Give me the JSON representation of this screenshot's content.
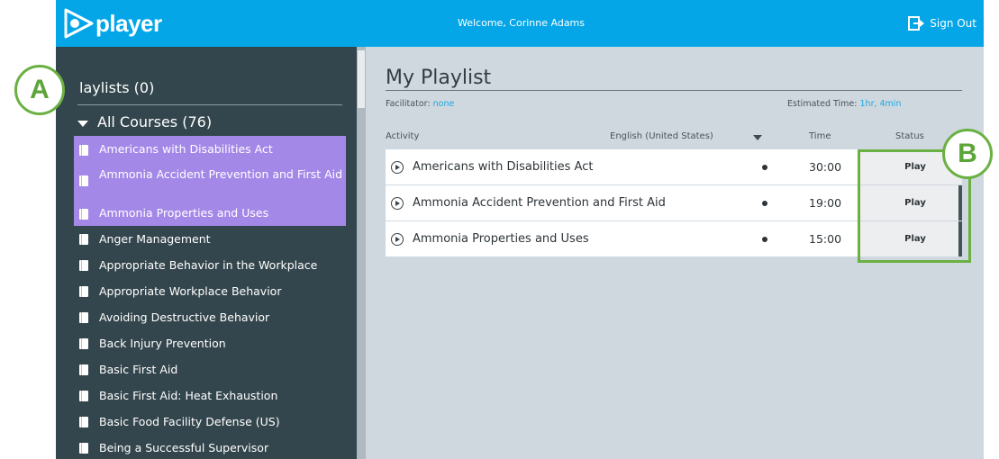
{
  "header": {
    "logo_text": "player",
    "welcome": "Welcome, Corinne Adams",
    "sign_out": "Sign Out"
  },
  "sidebar": {
    "playlists_label": "laylists (0)",
    "all_courses_label": "All Courses",
    "all_courses_count": "(76)",
    "courses": [
      "Americans with Disabilities Act",
      "Ammonia Accident Prevention and First Aid",
      "Ammonia Properties and Uses",
      "Anger Management",
      "Appropriate Behavior in the Workplace",
      "Appropriate Workplace Behavior",
      "Avoiding Destructive Behavior",
      "Back Injury Prevention",
      "Basic First Aid",
      "Basic First Aid: Heat Exhaustion",
      "Basic Food Facility Defense (US)",
      "Being a Successful Supervisor"
    ]
  },
  "main": {
    "title": "My Playlist",
    "facilitator_label": "Facilitator:",
    "facilitator_value": "none",
    "estimated_label": "Estimated Time:",
    "estimated_value": "1hr, 4min",
    "columns": {
      "activity": "Activity",
      "language": "English (United States)",
      "time": "Time",
      "status": "Status"
    },
    "rows": [
      {
        "title": "Americans with Disabilities Act",
        "time": "30:00",
        "status": "Play"
      },
      {
        "title": "Ammonia Accident Prevention and First Aid",
        "time": "19:00",
        "status": "Play"
      },
      {
        "title": "Ammonia Properties and Uses",
        "time": "15:00",
        "status": "Play"
      }
    ]
  },
  "annotations": {
    "a": "A",
    "b": "B"
  },
  "colors": {
    "header": "#04a6e8",
    "sidebar": "#34464d",
    "selected": "#a488e8",
    "callout": "#6bb042"
  }
}
